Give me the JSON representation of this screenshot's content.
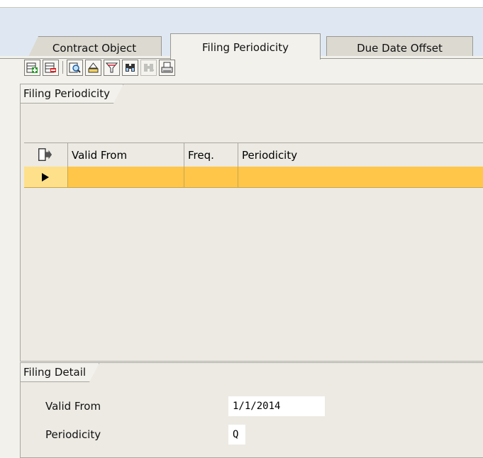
{
  "tabs": [
    {
      "label": "Contract Object"
    },
    {
      "label": "Filing Periodicity"
    },
    {
      "label": "Due Date Offset"
    }
  ],
  "active_tab": "Filing Periodicity",
  "filing_periodicity_group": {
    "title": "Filing Periodicity",
    "toolbar": [
      {
        "icon": "insert-row-icon",
        "enabled": true
      },
      {
        "icon": "delete-row-icon",
        "enabled": true
      },
      {
        "icon": "details-icon",
        "enabled": true
      },
      {
        "icon": "sort-icon",
        "enabled": true
      },
      {
        "icon": "filter-icon",
        "enabled": true
      },
      {
        "icon": "find-icon",
        "enabled": true
      },
      {
        "icon": "find-next-icon",
        "enabled": false
      },
      {
        "icon": "print-icon",
        "enabled": true
      }
    ],
    "table": {
      "columns": [
        "Valid From",
        "Freq.",
        "Periodicity"
      ],
      "rows": [
        {
          "valid_from": "",
          "freq": "",
          "periodicity": "",
          "selected": true
        }
      ]
    }
  },
  "filing_detail_group": {
    "title": "Filing Detail",
    "fields": [
      {
        "label": "Valid From",
        "value": "1/1/2014"
      },
      {
        "label": "Periodicity",
        "value": "Q"
      }
    ]
  },
  "colors": {
    "selected_row": "#ffc64a",
    "tab_bar": "#dfe8f2",
    "background": "#f2f1ec"
  }
}
